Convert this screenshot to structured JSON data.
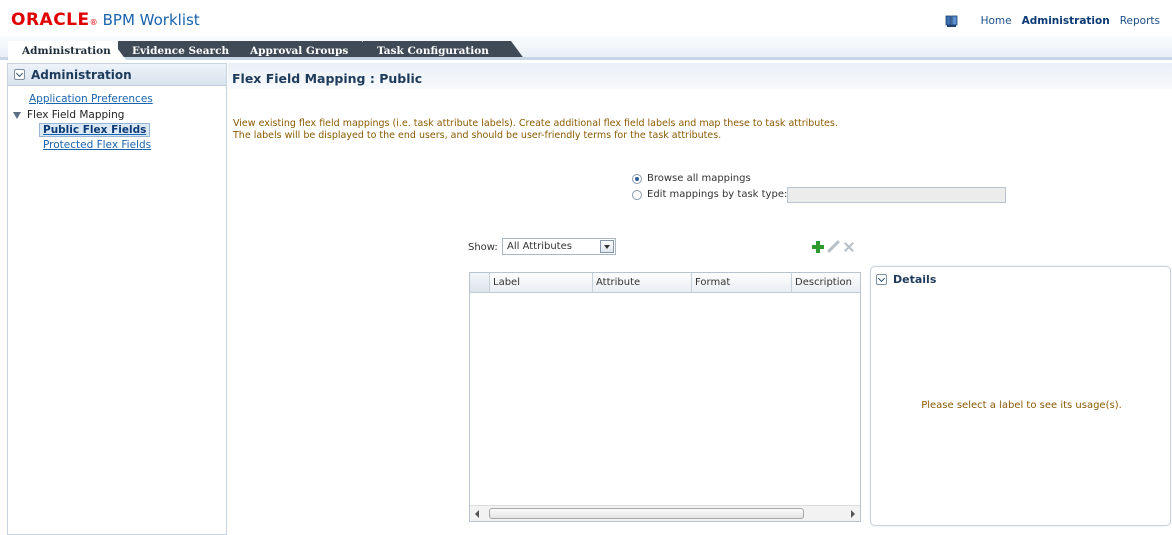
{
  "header": {
    "logo_brand": "ORACLE",
    "logo_reg": "®",
    "app_name": "BPM Worklist",
    "nav": {
      "home": "Home",
      "administration": "Administration",
      "reports": "Reports"
    }
  },
  "tabs": [
    {
      "label": "Administration",
      "active": true
    },
    {
      "label": "Evidence Search"
    },
    {
      "label": "Approval Groups"
    },
    {
      "label": "Task Configuration"
    }
  ],
  "sidebar": {
    "title": "Administration",
    "items": [
      {
        "label": "Application Preferences"
      },
      {
        "label": "Flex Field Mapping"
      },
      {
        "label": "Public Flex Fields",
        "selected": true
      },
      {
        "label": "Protected Flex Fields"
      }
    ]
  },
  "main": {
    "title": "Flex Field Mapping : Public",
    "description_line1": "View existing flex field mappings (i.e. task attribute labels). Create additional flex field labels and map these to task attributes.",
    "description_line2": "The labels will be displayed to the end users, and should be user-friendly terms for the task attributes.",
    "radio_browse": "Browse all mappings",
    "radio_edit": "Edit mappings by task type:",
    "tasktype_value": "",
    "show_label": "Show:",
    "show_value": "All Attributes",
    "table": {
      "columns": [
        "Label",
        "Attribute",
        "Format",
        "Description"
      ],
      "rows": []
    },
    "scroll_grip": "III",
    "details_title": "Details",
    "details_message": "Please select a label to see its usage(s)."
  },
  "colors": {
    "accent": "#1a64ae",
    "brand_red": "#e00000",
    "hint_text": "#8a5a00",
    "tab_dark": "#3f4a56",
    "add_green": "#2e9a2e"
  },
  "icons": [
    "help-book-icon",
    "chevron-down-icon",
    "tree-expand-icon",
    "add-icon",
    "edit-icon",
    "delete-icon"
  ]
}
